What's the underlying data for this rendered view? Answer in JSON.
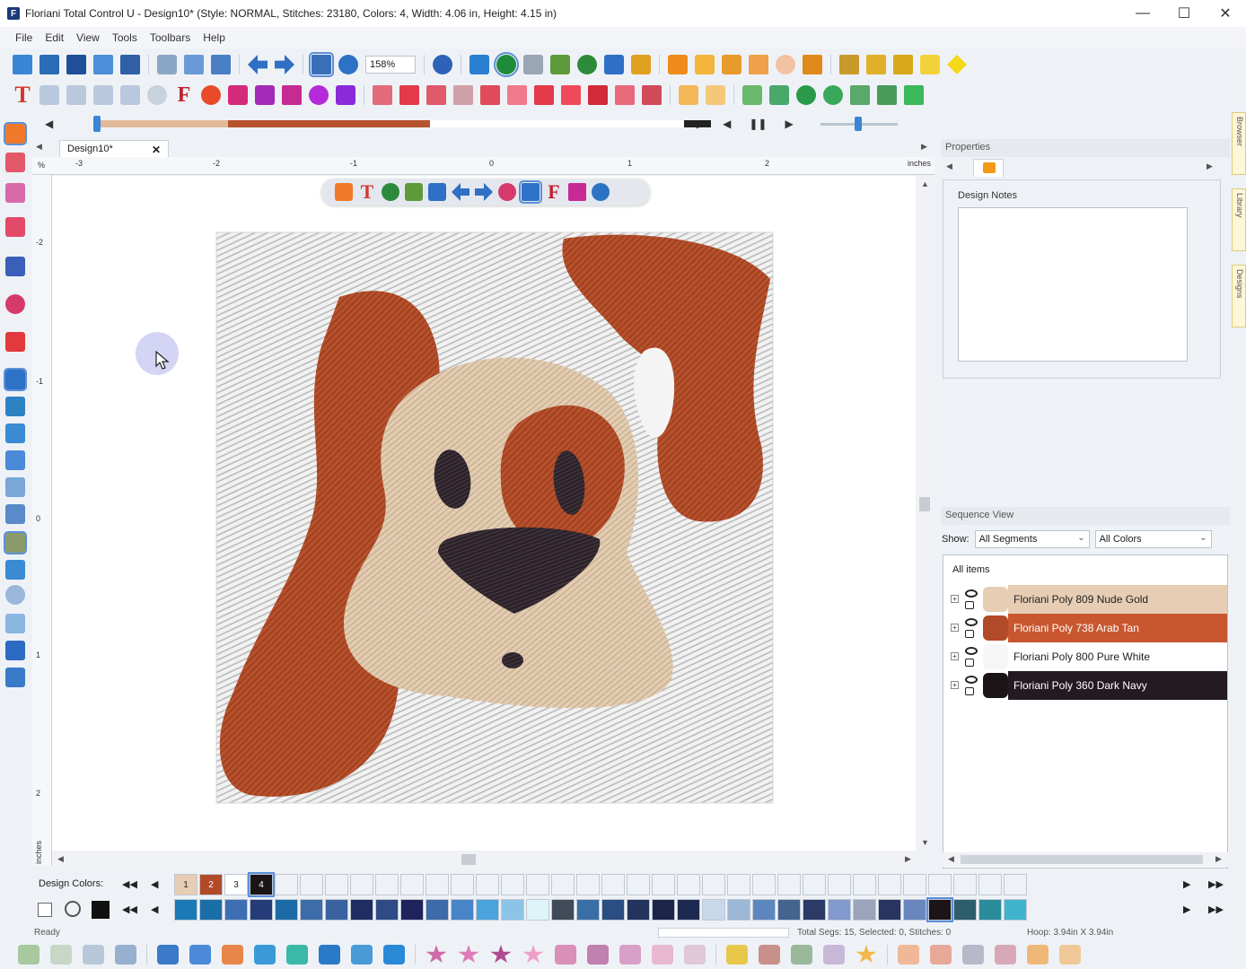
{
  "window": {
    "title": "Floriani Total Control U - Design10* (Style: NORMAL, Stitches: 23180, Colors: 4, Width: 4.06 in, Height: 4.15 in)"
  },
  "menu": [
    "File",
    "Edit",
    "View",
    "Tools",
    "Toolbars",
    "Help"
  ],
  "toolbar": {
    "zoom": "158%"
  },
  "document": {
    "tab_label": "Design10*",
    "ruler_unit": "inches",
    "ruler_x": [
      "-3",
      "-2",
      "-1",
      "0",
      "1",
      "2"
    ],
    "ruler_y": [
      "-2",
      "-1",
      "0",
      "1",
      "2"
    ],
    "ruler_y_unit": "inches"
  },
  "properties": {
    "header": "Properties",
    "design_notes_label": "Design Notes",
    "design_notes": ""
  },
  "sequence": {
    "header": "Sequence View",
    "show_label": "Show:",
    "segments_filter": "All Segments",
    "colors_filter": "All Colors",
    "all_items": "All items",
    "items": [
      {
        "name": "Floriani Poly 809 Nude Gold",
        "color": "#e6cdb4",
        "text_color": "#222222"
      },
      {
        "name": "Floriani Poly 738 Arab Tan",
        "color": "#c8572f",
        "text_color": "#ffffff"
      },
      {
        "name": "Floriani Poly 800 Pure White",
        "color": "#ffffff",
        "text_color": "#222222"
      },
      {
        "name": "Floriani Poly 360 Dark Navy",
        "color": "#231a22",
        "text_color": "#ffffff"
      }
    ]
  },
  "side_tabs": [
    "Browser",
    "Library",
    "Designs"
  ],
  "design_colors": {
    "label": "Design Colors:",
    "used": [
      {
        "label": "1",
        "color": "#e6cdb4"
      },
      {
        "label": "2",
        "color": "#b24a2a"
      },
      {
        "label": "3",
        "color": "#ffffff"
      },
      {
        "label": "4",
        "color": "#1b1518"
      }
    ],
    "palette": [
      "#1b7ab6",
      "#1c6ea8",
      "#3e6eb3",
      "#263c79",
      "#1c6aa6",
      "#3d6da8",
      "#3a62a1",
      "#1f2e60",
      "#2e4b86",
      "#1f235c",
      "#3d6aa8",
      "#4a84c8",
      "#4aa3dc",
      "#8cc4e8",
      "#dff4f8",
      "#414a58",
      "#3a6fa5",
      "#2a4d82",
      "#22345e",
      "#1d2648",
      "#1c2a52",
      "#c7d8ea",
      "#9db7d6",
      "#5e86be",
      "#45638f",
      "#2b3a66",
      "#8199cc",
      "#9aa4ba",
      "#2a3460",
      "#6a86bf",
      "#1b1518",
      "#2d5e6c",
      "#2a8c9a",
      "#40b4cc"
    ]
  },
  "status": {
    "ready": "Ready",
    "info": "Total Segs: 15, Selected: 0, Stitches: 0",
    "hoop": "Hoop: 3.94in X 3.94in"
  }
}
